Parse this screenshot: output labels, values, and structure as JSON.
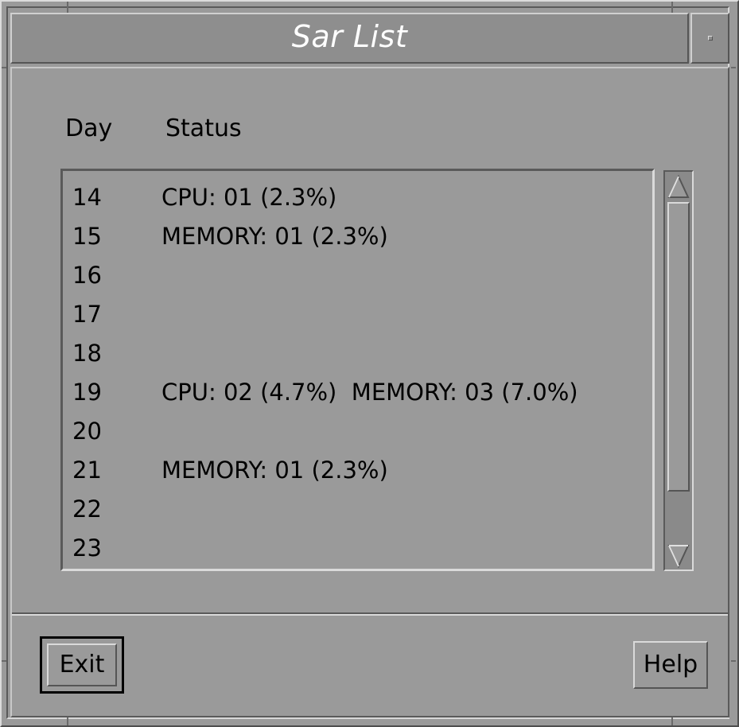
{
  "window": {
    "title": "Sar List"
  },
  "columns": {
    "day": "Day",
    "status": "Status"
  },
  "rows": [
    {
      "day": "14",
      "status": "CPU: 01 (2.3%)"
    },
    {
      "day": "15",
      "status": "MEMORY: 01 (2.3%)"
    },
    {
      "day": "16",
      "status": ""
    },
    {
      "day": "17",
      "status": ""
    },
    {
      "day": "18",
      "status": ""
    },
    {
      "day": "19",
      "status": "CPU: 02 (4.7%)  MEMORY: 03 (7.0%)"
    },
    {
      "day": "20",
      "status": ""
    },
    {
      "day": "21",
      "status": "MEMORY: 01 (2.3%)"
    },
    {
      "day": "22",
      "status": ""
    },
    {
      "day": "23",
      "status": ""
    }
  ],
  "buttons": {
    "exit": "Exit",
    "help": "Help"
  },
  "icons": {
    "scroll_up": "triangle-up-icon",
    "scroll_down": "triangle-down-icon",
    "maximize": "maximize-icon"
  }
}
